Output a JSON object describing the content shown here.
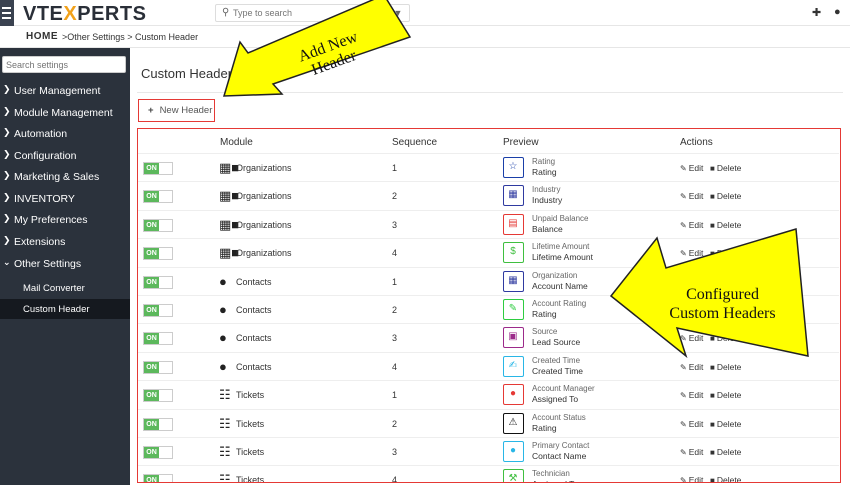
{
  "header": {
    "logo_a": "VTE",
    "logo_x": "X",
    "logo_b": "PERTS",
    "search_placeholder": "Type to search"
  },
  "breadcrumb": {
    "home": "HOME",
    "path": ">Other Settings > Custom Header"
  },
  "sidebar": {
    "search_placeholder": "Search settings",
    "items": [
      {
        "label": "User Management"
      },
      {
        "label": "Module Management"
      },
      {
        "label": "Automation"
      },
      {
        "label": "Configuration"
      },
      {
        "label": "Marketing & Sales"
      },
      {
        "label": "INVENTORY"
      },
      {
        "label": "My Preferences"
      },
      {
        "label": "Extensions"
      },
      {
        "label": "Other Settings"
      }
    ],
    "sub_items": [
      {
        "label": "Mail Converter"
      },
      {
        "label": "Custom Header"
      }
    ]
  },
  "main": {
    "title": "Custom Header",
    "new_button": "New Header",
    "columns": {
      "module": "Module",
      "sequence": "Sequence",
      "preview": "Preview",
      "actions": "Actions"
    },
    "toggle_label": "ON",
    "edit_label": "Edit",
    "delete_label": "Delete",
    "rows": [
      {
        "module": "Organizations",
        "seq": "1",
        "line1": "Rating",
        "line2": "Rating",
        "icon": "star-icon",
        "color": "#1a3fa8"
      },
      {
        "module": "Organizations",
        "seq": "2",
        "line1": "Industry",
        "line2": "Industry",
        "icon": "building-icon",
        "color": "#2f3aa0"
      },
      {
        "module": "Organizations",
        "seq": "3",
        "line1": "Unpaid Balance",
        "line2": "Balance",
        "icon": "invoice-icon",
        "color": "#e53935"
      },
      {
        "module": "Organizations",
        "seq": "4",
        "line1": "Lifetime Amount",
        "line2": "Lifetime Amount",
        "icon": "money-bag-icon",
        "color": "#3fbf3f"
      },
      {
        "module": "Contacts",
        "seq": "1",
        "line1": "Organization",
        "line2": "Account Name",
        "icon": "building-icon",
        "color": "#2f3aa0"
      },
      {
        "module": "Contacts",
        "seq": "2",
        "line1": "Account Rating",
        "line2": "Rating",
        "icon": "thumbs-up-icon",
        "color": "#2ecc40"
      },
      {
        "module": "Contacts",
        "seq": "3",
        "line1": "Source",
        "line2": "Lead Source",
        "icon": "clipboard-icon",
        "color": "#9c2a8a"
      },
      {
        "module": "Contacts",
        "seq": "4",
        "line1": "Created Time",
        "line2": "Created Time",
        "icon": "calendar-edit-icon",
        "color": "#29b6e6"
      },
      {
        "module": "Tickets",
        "seq": "1",
        "line1": "Account Manager",
        "line2": "Assigned To",
        "icon": "user-manager-icon",
        "color": "#e53935"
      },
      {
        "module": "Tickets",
        "seq": "2",
        "line1": "Account Status",
        "line2": "Rating",
        "icon": "warning-icon",
        "color": "#111111"
      },
      {
        "module": "Tickets",
        "seq": "3",
        "line1": "Primary Contact",
        "line2": "Contact Name",
        "icon": "contact-user-icon",
        "color": "#29b6e6"
      },
      {
        "module": "Tickets",
        "seq": "4",
        "line1": "Technician",
        "line2": "Assigned To",
        "icon": "technician-icon",
        "color": "#3fbf3f"
      }
    ]
  },
  "annotations": {
    "add_new": [
      "Add New",
      "Header"
    ],
    "configured": [
      "Configured",
      "Custom Headers"
    ],
    "accent": "#ffff00"
  }
}
